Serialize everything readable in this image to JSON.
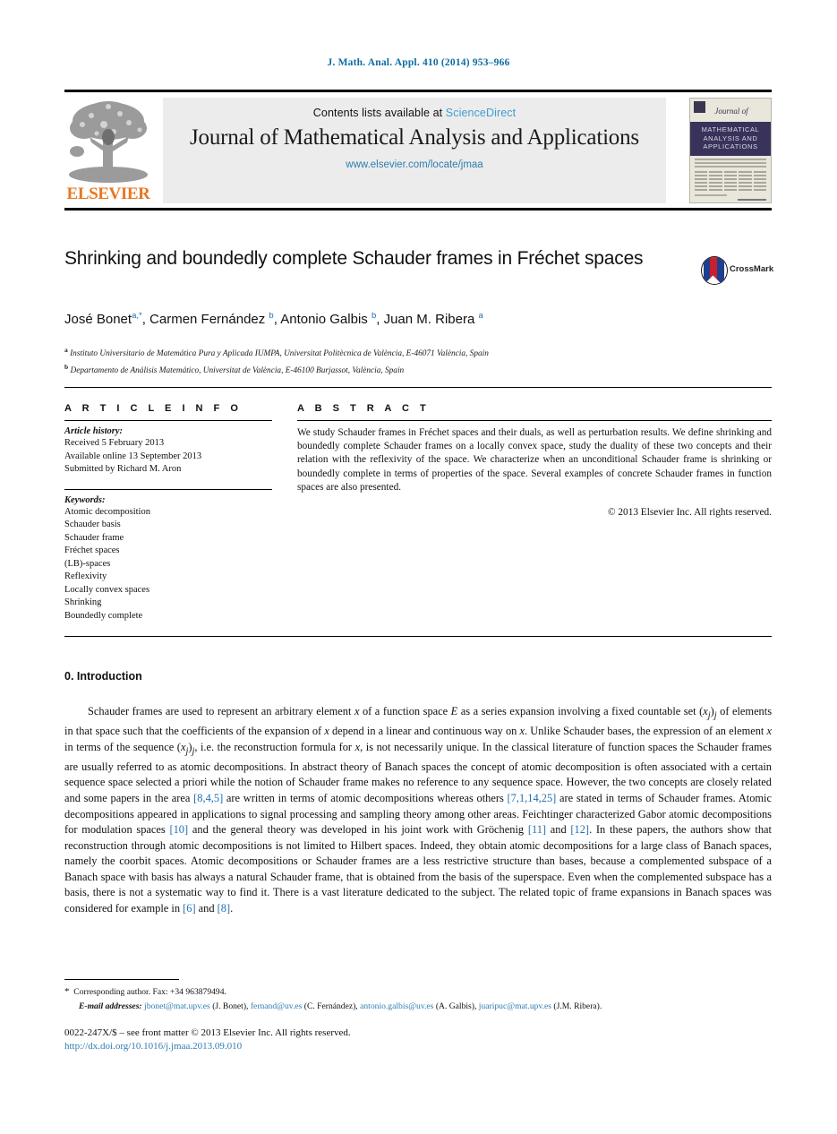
{
  "running_head": "J. Math. Anal. Appl. 410 (2014) 953–966",
  "masthead": {
    "contents_prefix": "Contents lists available at ",
    "sciencedirect": "ScienceDirect",
    "journal_title": "Journal of Mathematical Analysis and Applications",
    "journal_url": "www.elsevier.com/locate/jmaa",
    "publisher": "ELSEVIER",
    "cover": {
      "journal_of": "Journal of",
      "band_line1": "MATHEMATICAL",
      "band_line2": "ANALYSIS AND",
      "band_line3": "APPLICATIONS"
    }
  },
  "article": {
    "title": "Shrinking and boundedly complete Schauder frames in Fréchet spaces",
    "crossmark_label": "CrossMark",
    "authors_html": "José Bonet<sup>a,*</sup>, Carmen Fernández <sup>b</sup>, Antonio Galbis <sup>b</sup>, Juan M. Ribera <sup>a</sup>",
    "affiliation_a": "Instituto Universitario de Matemática Pura y Aplicada IUMPA, Universitat Politècnica de València, E-46071 València, Spain",
    "affiliation_b": "Departamento de Análisis Matemático, Universitat de València, E-46100 Burjassot, València, Spain"
  },
  "info": {
    "heading": "A R T I C L E   I N F O",
    "history_label": "Article history:",
    "history": [
      "Received 5 February 2013",
      "Available online 13 September 2013",
      "Submitted by Richard M. Aron"
    ],
    "keywords_label": "Keywords:",
    "keywords": [
      "Atomic decomposition",
      "Schauder basis",
      "Schauder frame",
      "Fréchet spaces",
      "(LB)-spaces",
      "Reflexivity",
      "Locally convex spaces",
      "Shrinking",
      "Boundedly complete"
    ]
  },
  "abstract": {
    "heading": "A B S T R A C T",
    "text": "We study Schauder frames in Fréchet spaces and their duals, as well as perturbation results. We define shrinking and boundedly complete Schauder frames on a locally convex space, study the duality of these two concepts and their relation with the reflexivity of the space. We characterize when an unconditional Schauder frame is shrinking or boundedly complete in terms of properties of the space. Several examples of concrete Schauder frames in function spaces are also presented.",
    "copyright": "© 2013 Elsevier Inc. All rights reserved."
  },
  "body": {
    "section_title": "0. Introduction",
    "paragraph_html": "Schauder frames are used to represent an arbitrary element <i>x</i> of a function space <i>E</i> as a series expansion involving a fixed countable set (<i>x<sub>j</sub></i>)<i><sub>j</sub></i> of elements in that space such that the coefficients of the expansion of <i>x</i> depend in a linear and continuous way on <i>x</i>. Unlike Schauder bases, the expression of an element <i>x</i> in terms of the sequence (<i>x<sub>j</sub></i>)<i><sub>j</sub></i>, i.e. the reconstruction formula for <i>x</i>, is not necessarily unique. In the classical literature of function spaces the Schauder frames are usually referred to as atomic decompositions. In abstract theory of Banach spaces the concept of atomic decomposition is often associated with a certain sequence space selected a priori while the notion of Schauder frame makes no reference to any sequence space. However, the two concepts are closely related and some papers in the area <span class=\"cit\">[8,4,5]</span> are written in terms of atomic decompositions whereas others <span class=\"cit\">[7,1,14,25]</span> are stated in terms of Schauder frames. Atomic decompositions appeared in applications to signal processing and sampling theory among other areas. Feichtinger characterized Gabor atomic decompositions for modulation spaces <span class=\"cit\">[10]</span> and the general theory was developed in his joint work with Gröchenig <span class=\"cit\">[11]</span> and <span class=\"cit\">[12]</span>. In these papers, the authors show that reconstruction through atomic decompositions is not limited to Hilbert spaces. Indeed, they obtain atomic decompositions for a large class of Banach spaces, namely the coorbit spaces. Atomic decompositions or Schauder frames are a less restrictive structure than bases, because a complemented subspace of a Banach space with basis has always a natural Schauder frame, that is obtained from the basis of the superspace. Even when the complemented subspace has a basis, there is not a systematic way to find it. There is a vast literature dedicated to the subject. The related topic of frame expansions in Banach spaces was considered for example in <span class=\"cit\">[6]</span> and <span class=\"cit\">[8]</span>."
  },
  "footnotes": {
    "corresponding": "Corresponding author. Fax: +34 963879494.",
    "email_label": "E-mail addresses:",
    "emails": [
      {
        "address": "jbonet@mat.upv.es",
        "person": "(J. Bonet),"
      },
      {
        "address": "fernand@uv.es",
        "person": "(C. Fernández),"
      },
      {
        "address": "antonio.galbis@uv.es",
        "person": "(A. Galbis),"
      },
      {
        "address": "juaripuc@mat.upv.es",
        "person": "(J.M. Ribera)."
      }
    ]
  },
  "footer": {
    "issn": "0022-247X/$ – see front matter © 2013 Elsevier Inc. All rights reserved.",
    "doi": "http://dx.doi.org/10.1016/j.jmaa.2013.09.010"
  },
  "colors": {
    "link_blue": "#2e7db0",
    "citation_blue": "#1f6fb2",
    "running_head_blue": "#0d6ba0",
    "sciencedirect_blue": "#3f9fd0",
    "elsevier_orange": "#e87722",
    "cover_band": "#39335c"
  }
}
